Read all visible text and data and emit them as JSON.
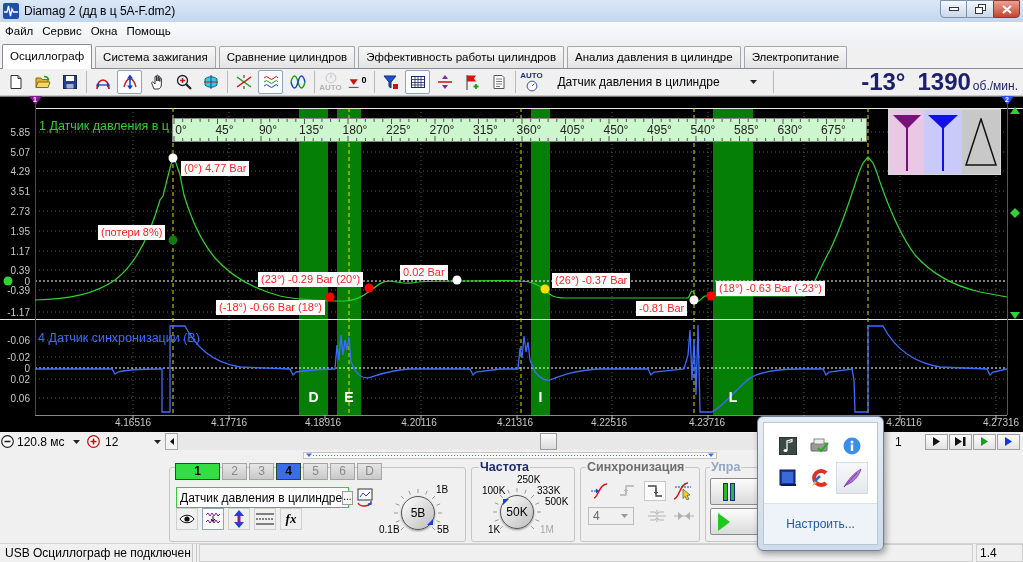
{
  "window": {
    "title": "Diamag 2 (дд в ц 5A-F.dm2)"
  },
  "menu": [
    "Файл",
    "Сервис",
    "Окна",
    "Помощь"
  ],
  "tabs": [
    {
      "label": "Осциллограф",
      "selected": true
    },
    {
      "label": "Система зажигания",
      "selected": false
    },
    {
      "label": "Сравнение цилиндров",
      "selected": false
    },
    {
      "label": "Эффективность работы цилиндров",
      "selected": false
    },
    {
      "label": "Анализ давления в цилиндре",
      "selected": false
    },
    {
      "label": "Электропитание",
      "selected": false
    }
  ],
  "toolbar": {
    "groups": [
      [
        {
          "kind": "new",
          "pressed": false,
          "disabled": false
        },
        {
          "kind": "open",
          "pressed": false,
          "disabled": false
        },
        {
          "kind": "save",
          "pressed": false,
          "disabled": false
        }
      ],
      [
        {
          "kind": "span",
          "pressed": false,
          "disabled": false
        },
        {
          "kind": "cursor",
          "pressed": true,
          "disabled": false
        },
        {
          "kind": "hand",
          "pressed": false,
          "disabled": false
        },
        {
          "kind": "zoom",
          "pressed": false,
          "disabled": false
        },
        {
          "kind": "fit",
          "pressed": false,
          "disabled": false
        }
      ],
      [
        {
          "kind": "cross",
          "pressed": false,
          "disabled": false
        },
        {
          "kind": "waves",
          "pressed": true,
          "disabled": false
        },
        {
          "kind": "sine",
          "pressed": false,
          "disabled": false
        }
      ],
      [
        {
          "kind": "auto",
          "pressed": false,
          "disabled": true,
          "label": "AUTO"
        },
        {
          "kind": "zero",
          "pressed": false,
          "disabled": false,
          "label": "0"
        }
      ],
      [
        {
          "kind": "filter",
          "pressed": false,
          "disabled": false
        },
        {
          "kind": "grid",
          "pressed": true,
          "disabled": false
        },
        {
          "kind": "split",
          "pressed": false,
          "disabled": false
        },
        {
          "kind": "flag",
          "pressed": false,
          "disabled": false
        },
        {
          "kind": "list",
          "pressed": false,
          "disabled": false
        }
      ],
      [
        {
          "kind": "gauge",
          "pressed": false,
          "disabled": false,
          "label": "AUTO"
        }
      ]
    ],
    "sensor": "Датчик давления в цилиндре",
    "angle": "-13°",
    "rpm": "1390",
    "rpm_unit": "об./мин."
  },
  "oscillogram": {
    "cursors": [
      "1",
      "2"
    ],
    "ruler": [
      "0°",
      "45°",
      "90°",
      "135°",
      "180°",
      "225°",
      "270°",
      "315°",
      "360°",
      "405°",
      "450°",
      "495°",
      "540°",
      "585°",
      "630°",
      "675°"
    ],
    "channel_1": {
      "label": "1 Датчик давления в ц",
      "y_ticks": [
        "5.85",
        "5.07",
        "4.29",
        "3.51",
        "2.73",
        "1.95",
        "1.17",
        "0.39",
        "0",
        "-0.39",
        "-1.17"
      ]
    },
    "channel_4": {
      "label": "4 Датчик синхронизации (В)",
      "y_ticks": [
        "-0.06",
        "-0.02",
        "0",
        "0.02",
        "0.06"
      ]
    },
    "bands": [
      "D",
      "E",
      "I",
      "L"
    ],
    "annotations": [
      {
        "text": "(0°) 4.77 Bar",
        "color": "#ffffff"
      },
      {
        "text": "(потери 8%)",
        "color": "#0c7a0c"
      },
      {
        "text": "(23°) -0.29 Bar (20°)",
        "color": "#ff0000"
      },
      {
        "text": "(-18°) -0.66 Bar (18°)",
        "color": "#ff0000"
      },
      {
        "text": "0.02 Bar",
        "color": "#ffffff"
      },
      {
        "text": "(26°) -0.37 Bar",
        "color": "#ffe000"
      },
      {
        "text": "-0.81 Bar",
        "color": "#ffffff"
      },
      {
        "text": "(18°) -0.63 Bar (-23°)",
        "color": "#ff0000"
      }
    ],
    "x_ticks": [
      "4.16516",
      "4.17716",
      "4.18916",
      "4.20116",
      "4.21316",
      "4.22516",
      "4.23716",
      "4.26116",
      "4.27316"
    ]
  },
  "timeline": {
    "timebase": "120.8 мс",
    "gain": "12",
    "frame": "1"
  },
  "panel": {
    "channels": [
      {
        "label": "1",
        "on": true,
        "color": "#33dd44"
      },
      {
        "label": "2",
        "on": false
      },
      {
        "label": "3",
        "on": false
      },
      {
        "label": "4",
        "on": true,
        "color": "#3a6ee8"
      },
      {
        "label": "5",
        "on": false
      },
      {
        "label": "6",
        "on": false
      },
      {
        "label": "D",
        "on": false
      }
    ],
    "sensor": "Датчик давления в цилиндре",
    "browse": "...",
    "channel_tools": [
      {
        "kind": "eye",
        "pressed": false
      },
      {
        "kind": "wave",
        "pressed": true
      },
      {
        "kind": "arrows",
        "pressed": false
      },
      {
        "kind": "lines",
        "pressed": false
      },
      {
        "kind": "formula",
        "pressed": false,
        "label": "fx"
      }
    ],
    "volts": {
      "value": "5В",
      "scale": [
        "1В",
        "0.1В",
        "5В"
      ]
    },
    "frequency": {
      "title": "Частота",
      "value": "50K",
      "scale": [
        {
          "text": "100K",
          "disabled": false
        },
        {
          "text": "250K",
          "disabled": false
        },
        {
          "text": "333K",
          "disabled": false
        },
        {
          "text": "500K",
          "disabled": false
        },
        {
          "text": "1K",
          "disabled": false
        },
        {
          "text": "1M",
          "disabled": true
        }
      ]
    },
    "sync": {
      "title": "Синхронизация",
      "tools": [
        {
          "kind": "slope",
          "pressed": false,
          "disabled": false
        },
        {
          "kind": "rising",
          "pressed": false,
          "disabled": true
        },
        {
          "kind": "falling",
          "pressed": true,
          "disabled": false
        },
        {
          "kind": "pointer",
          "pressed": false,
          "disabled": false
        }
      ],
      "channel": {
        "value": "4",
        "disabled": true
      },
      "extra": [
        {
          "kind": "gap",
          "disabled": true
        },
        {
          "kind": "join",
          "disabled": true
        }
      ]
    },
    "control": {
      "title": "Упра"
    }
  },
  "status_bar": {
    "message": "USB Осциллограф не подключен",
    "field_3": "1.4"
  },
  "tray_popup": {
    "icons": [
      {
        "kind": "note",
        "selected": false
      },
      {
        "kind": "printer",
        "selected": false
      },
      {
        "kind": "info",
        "selected": false
      },
      {
        "kind": "device",
        "selected": false
      },
      {
        "kind": "cleaner",
        "selected": false
      },
      {
        "kind": "feather",
        "selected": true
      }
    ],
    "link": "Настроить..."
  }
}
